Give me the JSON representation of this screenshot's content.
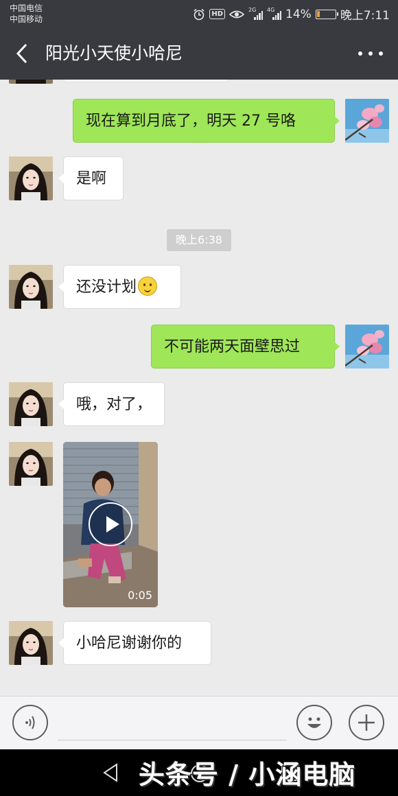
{
  "status_bar": {
    "carrier1": "中国电信",
    "carrier2": "中国移动",
    "hd": "HD",
    "net1": "2G",
    "net2": "4G",
    "battery": "14%",
    "battery_level": 0.14,
    "time": "晚上7:11"
  },
  "header": {
    "title": "阳光小天使小哈尼"
  },
  "messages": [
    {
      "side": "right",
      "text": "现在算到月底了，明天 27 号咯"
    },
    {
      "side": "left",
      "text": "是啊"
    },
    {
      "side": "left",
      "text": "还没计划",
      "emoji": "smile-emoji"
    },
    {
      "side": "right",
      "text": "不可能两天面壁思过"
    },
    {
      "side": "left",
      "text": "哦，对了，"
    },
    {
      "side": "left",
      "type": "video",
      "duration": "0:05"
    },
    {
      "side": "left",
      "text": "小哈尼谢谢你的"
    }
  ],
  "time_divider": "晚上6:38",
  "input_bar": {
    "voice_icon": "voice-icon",
    "emoji_icon": "emoji-icon",
    "plus_icon": "plus-icon"
  },
  "watermark": "头条号 / 小涵电脑",
  "colors": {
    "header_bg": "#393a3f",
    "chat_bg": "#ebebeb",
    "sent_bubble": "#9fe658",
    "received_bubble": "#ffffff"
  }
}
